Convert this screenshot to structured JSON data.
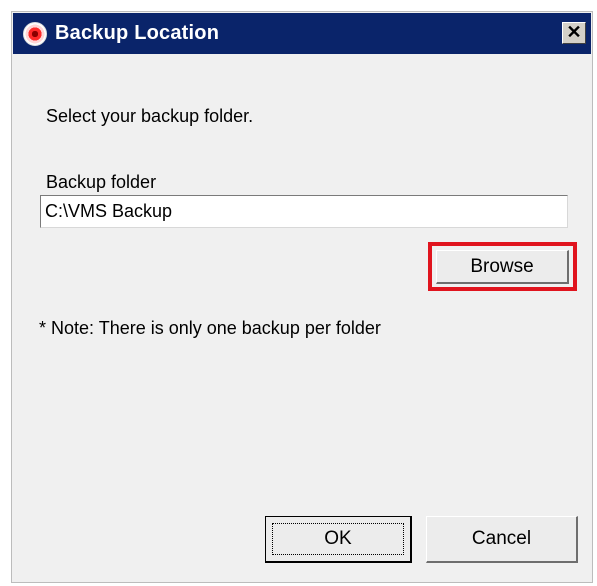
{
  "window": {
    "title": "Backup Location",
    "close_glyph": "✕",
    "icon": "app-eye-icon"
  },
  "content": {
    "prompt": "Select your backup folder.",
    "folder_label": "Backup folder",
    "folder_value": "C:\\VMS Backup",
    "browse_label": "Browse",
    "note": "* Note: There is only one backup per folder"
  },
  "footer": {
    "ok_label": "OK",
    "cancel_label": "Cancel"
  },
  "colors": {
    "titlebar": "#0a246a",
    "highlight": "#e0141e",
    "dialog_bg": "#f0f0f0"
  }
}
